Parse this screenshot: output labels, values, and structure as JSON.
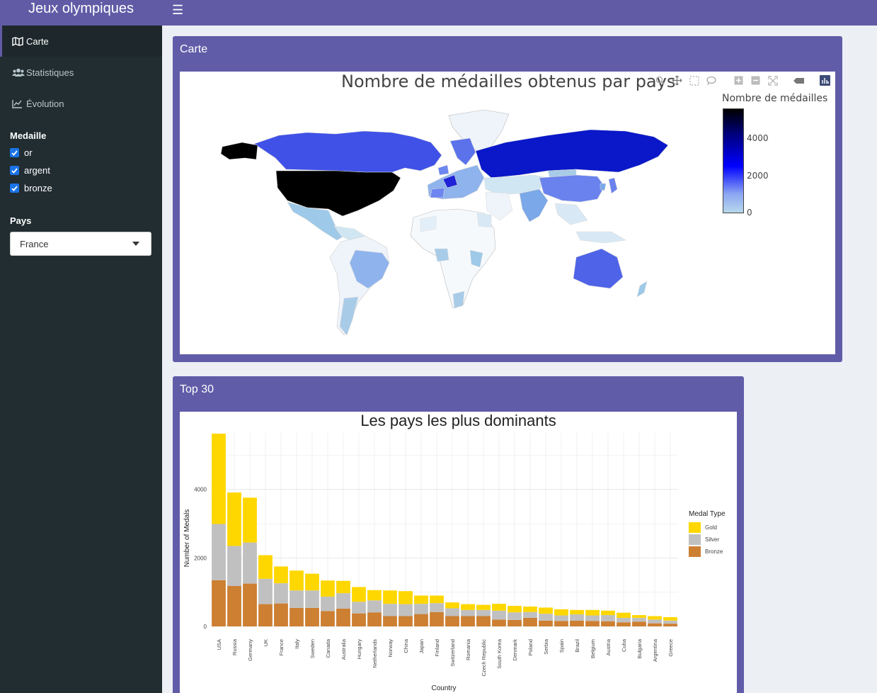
{
  "app": {
    "title": "Jeux olympiques"
  },
  "header": {
    "toggle_icon": "hamburger-icon"
  },
  "sidebar": {
    "menu": [
      {
        "label": "Carte",
        "icon": "map-icon",
        "active": true
      },
      {
        "label": "Statistiques",
        "icon": "users-icon",
        "active": false
      },
      {
        "label": "Évolution",
        "icon": "line-chart-icon",
        "active": false
      }
    ],
    "medal_filter": {
      "label": "Medaille",
      "options": [
        {
          "label": "or",
          "checked": true
        },
        {
          "label": "argent",
          "checked": true
        },
        {
          "label": "bronze",
          "checked": true
        }
      ]
    },
    "country_filter": {
      "label": "Pays",
      "selected": "France"
    }
  },
  "map_box": {
    "title": "Carte",
    "plot_title": "Nombre de médailles obtenus par pays",
    "colorbar": {
      "title": "Nombre de médailles",
      "ticks": [
        "4000",
        "2000",
        "0"
      ]
    },
    "modebar": [
      "zoom-icon",
      "pan-icon",
      "box-select-icon",
      "lasso-icon",
      "zoom-in-icon",
      "zoom-out-icon",
      "autoscale-icon",
      "hover-icon",
      "plotly-logo-icon"
    ]
  },
  "top_box": {
    "title": "Top 30"
  },
  "chart_data": {
    "type": "bar",
    "title": "Les pays les plus dominants",
    "xlabel": "Country",
    "ylabel": "Number of Medals",
    "ylim": [
      0,
      5650
    ],
    "yticks": [
      "0",
      "2000",
      "4000"
    ],
    "legend": {
      "title": "Medal Type",
      "position": "right"
    },
    "categories": [
      "USA",
      "Russia",
      "Germany",
      "UK",
      "France",
      "Italy",
      "Sweden",
      "Canada",
      "Australia",
      "Hungary",
      "Netherlands",
      "Norway",
      "China",
      "Japan",
      "Finland",
      "Switzerland",
      "Romania",
      "Czech Republic",
      "South Korea",
      "Denmark",
      "Poland",
      "Serbia",
      "Spain",
      "Brazil",
      "Belgium",
      "Austria",
      "Cuba",
      "Bulgaria",
      "Argentina",
      "Greece"
    ],
    "series": [
      {
        "name": "Bronze",
        "color": "#cd7f32",
        "values": [
          1350,
          1180,
          1250,
          650,
          670,
          540,
          540,
          450,
          520,
          380,
          410,
          300,
          300,
          360,
          420,
          300,
          300,
          300,
          200,
          190,
          250,
          170,
          160,
          170,
          160,
          150,
          120,
          140,
          90,
          80
        ]
      },
      {
        "name": "Silver",
        "color": "#c0c0c0",
        "values": [
          1640,
          1170,
          1200,
          740,
          590,
          510,
          510,
          420,
          450,
          340,
          350,
          360,
          350,
          300,
          260,
          230,
          180,
          180,
          260,
          220,
          170,
          200,
          160,
          180,
          160,
          180,
          130,
          110,
          110,
          90
        ]
      },
      {
        "name": "Gold",
        "color": "#ffd700",
        "values": [
          2640,
          1560,
          1310,
          690,
          490,
          580,
          490,
          470,
          360,
          430,
          300,
          390,
          380,
          240,
          220,
          170,
          170,
          150,
          200,
          190,
          160,
          180,
          180,
          130,
          160,
          130,
          150,
          80,
          100,
          100
        ]
      }
    ]
  }
}
